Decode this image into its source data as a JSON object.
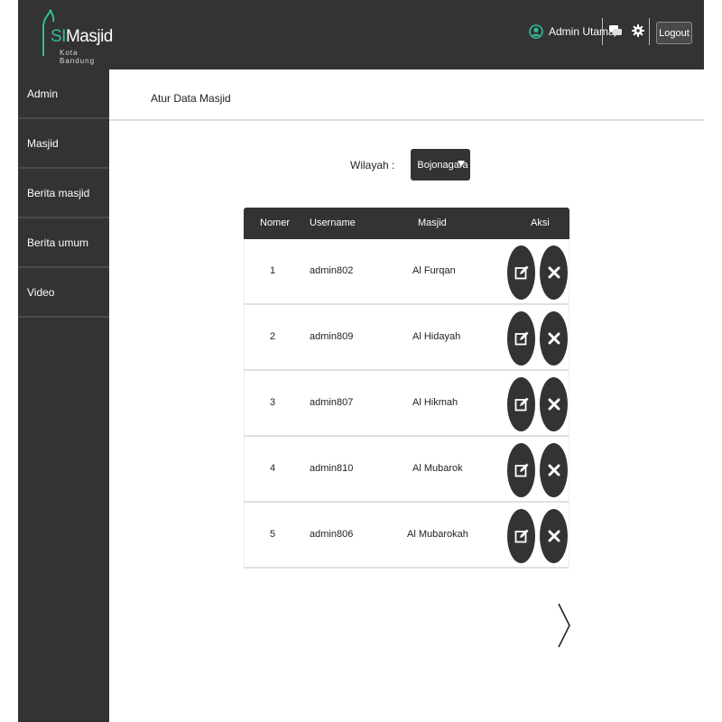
{
  "header": {
    "logo_prefix": "SI",
    "logo_title": "Masjid",
    "logo_sub": "Kota Bandung",
    "user_name": "Admin Utama",
    "logout_label": "Logout",
    "icons": [
      "user-icon",
      "chat-icon",
      "gear-icon"
    ]
  },
  "sidebar": {
    "items": [
      {
        "label": "Admin"
      },
      {
        "label": "Masjid"
      },
      {
        "label": "Berita masjid"
      },
      {
        "label": "Berita umum"
      },
      {
        "label": "Video"
      }
    ]
  },
  "page": {
    "title": "Atur Data Masjid"
  },
  "filter": {
    "label": "Wilayah  :",
    "value": "Bojonagara"
  },
  "table": {
    "columns": [
      "Nomer",
      "Username",
      "Masjid",
      "Aksi"
    ],
    "rows": [
      {
        "no": "1",
        "username": "admin802",
        "masjid": "Al Furqan"
      },
      {
        "no": "2",
        "username": "admin809",
        "masjid": "Al Hidayah"
      },
      {
        "no": "3",
        "username": "admin807",
        "masjid": "Al Hikmah"
      },
      {
        "no": "4",
        "username": "admin810",
        "masjid": "Al Mubarok"
      },
      {
        "no": "5",
        "username": "admin806",
        "masjid": "Al Mubarokah"
      }
    ]
  },
  "colors": {
    "dark": "#333333",
    "accent": "#2fbf9c",
    "background": "#ffffff"
  }
}
